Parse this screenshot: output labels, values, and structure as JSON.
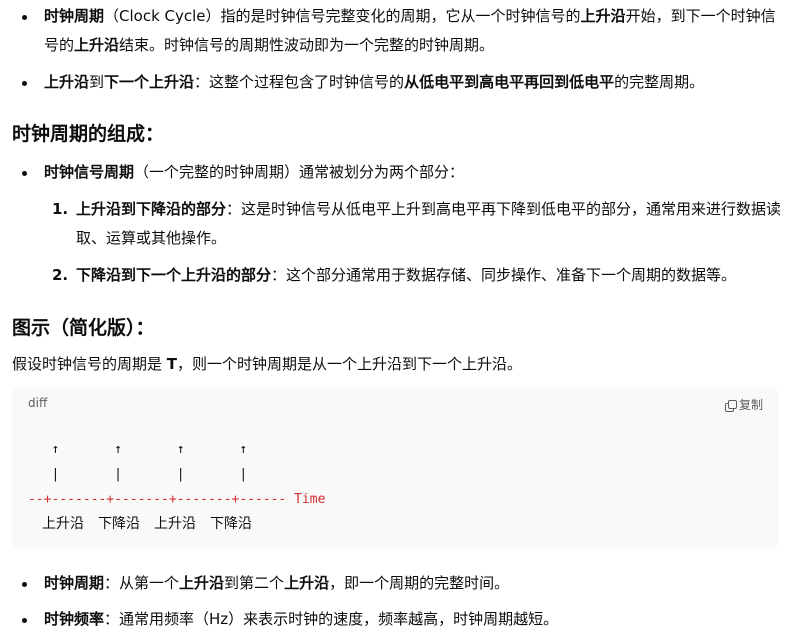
{
  "intro_list": [
    {
      "t1": "时钟周期",
      "t2": "（Clock Cycle）指的是时钟信号完整变化的周期，它从一个时钟信号的",
      "t3": "上升沿",
      "t4": "开始，到下一个时钟信号的",
      "t5": "上升沿",
      "t6": "结束。时钟信号的周期性波动即为一个完整的时钟周期。"
    },
    {
      "t1": "上升沿",
      "t2": "到",
      "t3": "下一个上升沿",
      "t4": "：这整个过程包含了时钟信号的",
      "t5": "从低电平到高电平再回到低电平",
      "t6": "的完整周期。"
    }
  ],
  "section1": {
    "heading": "时钟周期的组成：",
    "bullet": {
      "bold": "时钟信号周期",
      "rest": "（一个完整的时钟周期）通常被划分为两个部分："
    },
    "ordered": [
      {
        "num": "1.",
        "bold": "上升沿到下降沿的部分",
        "rest": "：这是时钟信号从低电平上升到高电平再下降到低电平的部分，通常用来进行数据读取、运算或其他操作。"
      },
      {
        "num": "2.",
        "bold": "下降沿到下一个上升沿的部分",
        "rest": "：这个部分通常用于数据存储、同步操作、准备下一个周期的数据等。"
      }
    ]
  },
  "section2": {
    "heading": "图示（简化版）：",
    "para_a": "假设时钟信号的周期是 ",
    "para_b": "T",
    "para_c": "，则一个时钟周期是从一个上升沿到下一个上升沿。"
  },
  "code": {
    "lang": "diff",
    "copy_label": "复制",
    "line_arrows": "   ↑       ↑       ↑       ↑",
    "line_bars": "   |       |       |       |",
    "line_axis": "--+-------+-------+-------+------ Time",
    "labels": [
      "上升沿",
      "下降沿",
      "上升沿",
      "下降沿"
    ]
  },
  "outro_list": [
    {
      "t1": "时钟周期",
      "t2": "：从第一个",
      "t3": "上升沿",
      "t4": "到第二个",
      "t5": "上升沿",
      "t6": "，即一个周期的完整时间。"
    },
    {
      "t1": "时钟频率",
      "t2": "：通常用频率（Hz）来表示时钟的速度，频率越高，时钟周期越短。"
    }
  ]
}
